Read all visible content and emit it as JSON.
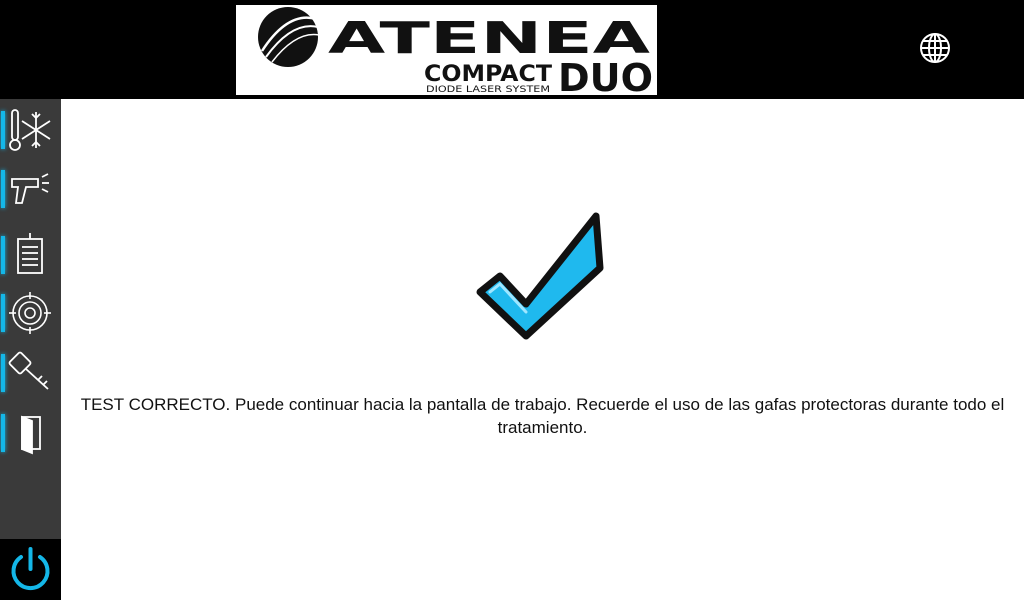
{
  "header": {
    "logo": {
      "brand": "ATENEA",
      "line1": "COMPACT",
      "line2": "DUO",
      "tagline": "DIODE LASER SYSTEM"
    },
    "language_icon": "globe-icon"
  },
  "sidebar": {
    "items": [
      {
        "icon": "thermometer-snowflake-icon"
      },
      {
        "icon": "laser-handpiece-icon"
      },
      {
        "icon": "document-icon"
      },
      {
        "icon": "target-calibration-icon"
      },
      {
        "icon": "key-icon"
      },
      {
        "icon": "exit-door-icon"
      }
    ],
    "power_icon": "power-icon",
    "accent_color": "#14b7e8"
  },
  "main": {
    "status_icon": "checkmark-icon",
    "message": "TEST CORRECTO. Puede continuar hacia la pantalla de trabajo. Recuerde el uso de las gafas protectoras durante todo el tratamiento."
  }
}
